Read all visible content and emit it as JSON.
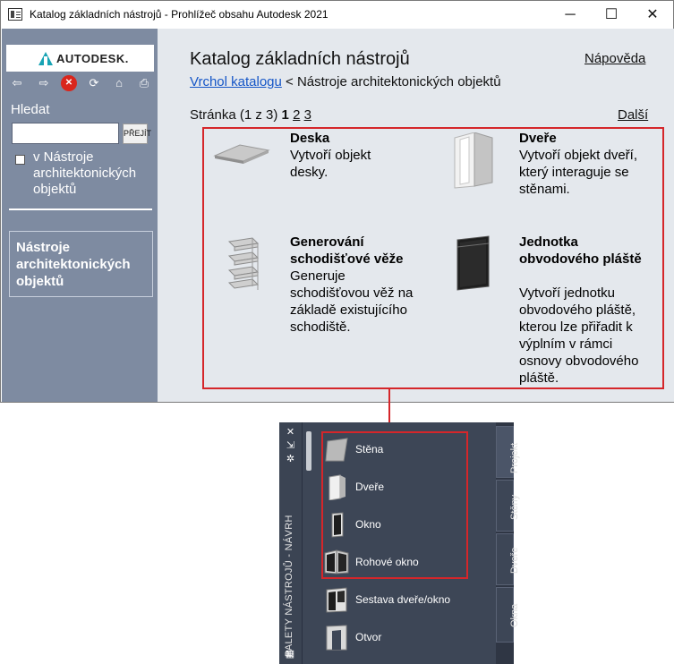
{
  "window": {
    "title": "Katalog základních nástrojů - Prohlížeč obsahu Autodesk 2021",
    "controls": {
      "minimize": "─",
      "maximize": "☐",
      "close": "✕"
    }
  },
  "sidebar": {
    "logo_text": "AUTODESK.",
    "nav_icons": [
      "back-icon",
      "forward-icon",
      "stop-icon",
      "refresh-icon",
      "home-icon",
      "print-icon"
    ],
    "nav_glyphs": {
      "back": "⇦",
      "forward": "⇨",
      "stop": "✕",
      "refresh": "⟳",
      "home": "⌂",
      "print": "⎙"
    },
    "search_label": "Hledat",
    "search_value": "",
    "go_button": "PŘEJÍT",
    "scope_label": "v Nástroje architektonických objektů",
    "current_category": "Nástroje architektonických objektů"
  },
  "main": {
    "heading": "Katalog základních nástrojů",
    "help_link": "Nápověda",
    "breadcrumb": {
      "root": "Vrchol katalogu",
      "separator": " < ",
      "current": "Nástroje architektonických objektů"
    },
    "pager": {
      "prefix": "Stránka (1 z 3)",
      "current": "1",
      "pages": [
        "2",
        "3"
      ],
      "next": "Další"
    },
    "tools": [
      {
        "name": "Deska",
        "description": "Vytvoří objekt desky."
      },
      {
        "name": "Dveře",
        "description": "Vytvoří objekt dveří, který interaguje se stěnami."
      },
      {
        "name": "Generování schodišťové věže",
        "description": "Generuje schodišťovou věž na základě existujícího schodiště."
      },
      {
        "name": "Jednotka obvodového pláště",
        "description": "Vytvoří jednotku obvodového pláště, kterou lze přiřadit k výplním v rámci osnovy obvodového pláště."
      }
    ]
  },
  "palette": {
    "title": "PALETY NÁSTROJŮ - NÁVRH",
    "strip_glyphs": {
      "close": "✕",
      "autohide": "⇲",
      "properties": "✲",
      "menu": "▦"
    },
    "items": [
      {
        "label": "Stěna",
        "icon": "wall-icon"
      },
      {
        "label": "Dveře",
        "icon": "door-icon"
      },
      {
        "label": "Okno",
        "icon": "window-icon"
      },
      {
        "label": "Rohové okno",
        "icon": "corner-window-icon"
      },
      {
        "label": "Sestava dveře/okno",
        "icon": "door-window-assembly-icon"
      },
      {
        "label": "Otvor",
        "icon": "opening-icon"
      }
    ],
    "tabs": [
      "Projekt",
      "Stěny",
      "Dveře",
      "Okna"
    ],
    "active_tab": "Projekt"
  },
  "colors": {
    "sidebar_bg": "#7e8ba1",
    "content_bg": "#e4e8ed",
    "highlight_frame": "#d5262a",
    "link": "#1556c7",
    "palette_bg": "#3d4656",
    "logo_mark": "#17a3b4"
  }
}
